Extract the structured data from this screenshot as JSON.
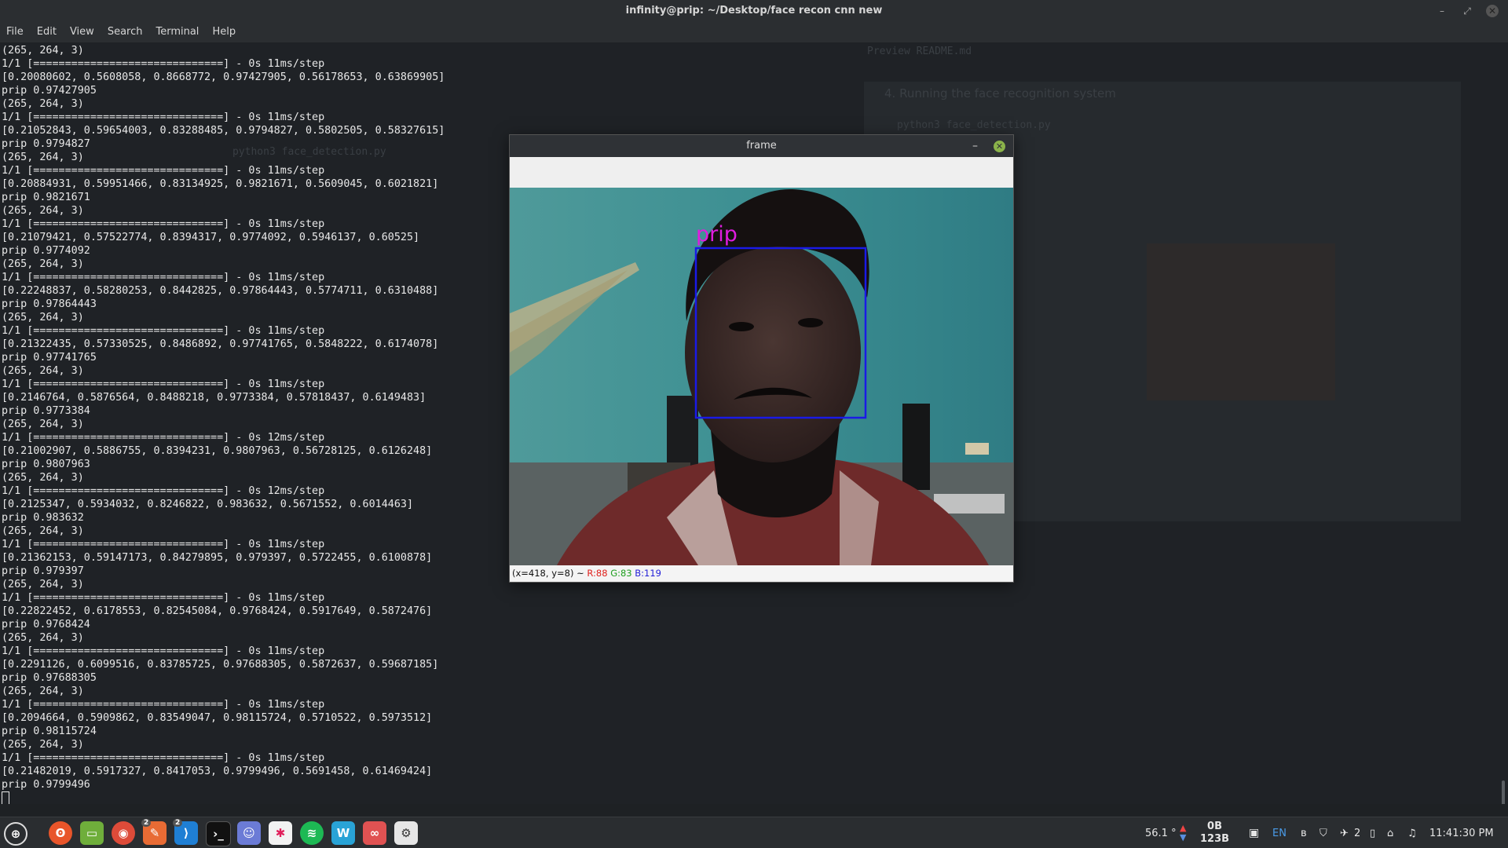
{
  "window": {
    "title": "infinity@prip: ~/Desktop/face recon cnn new"
  },
  "menu": [
    "File",
    "Edit",
    "View",
    "Search",
    "Terminal",
    "Help"
  ],
  "terminal": {
    "lines": [
      "(265, 264, 3)",
      "1/1 [==============================] - 0s 11ms/step",
      "[0.20080602, 0.5608058, 0.8668772, 0.97427905, 0.56178653, 0.63869905]",
      "prip 0.97427905",
      "(265, 264, 3)",
      "1/1 [==============================] - 0s 11ms/step",
      "[0.21052843, 0.59654003, 0.83288485, 0.9794827, 0.5802505, 0.58327615]",
      "prip 0.9794827",
      "(265, 264, 3)",
      "1/1 [==============================] - 0s 11ms/step",
      "[0.20884931, 0.59951466, 0.83134925, 0.9821671, 0.5609045, 0.6021821]",
      "prip 0.9821671",
      "(265, 264, 3)",
      "1/1 [==============================] - 0s 11ms/step",
      "[0.21079421, 0.57522774, 0.8394317, 0.9774092, 0.5946137, 0.60525]",
      "prip 0.9774092",
      "(265, 264, 3)",
      "1/1 [==============================] - 0s 11ms/step",
      "[0.22248837, 0.58280253, 0.8442825, 0.97864443, 0.5774711, 0.6310488]",
      "prip 0.97864443",
      "(265, 264, 3)",
      "1/1 [==============================] - 0s 11ms/step",
      "[0.21322435, 0.57330525, 0.8486892, 0.97741765, 0.5848222, 0.6174078]",
      "prip 0.97741765",
      "(265, 264, 3)",
      "1/1 [==============================] - 0s 11ms/step",
      "[0.2146764, 0.5876564, 0.8488218, 0.9773384, 0.57818437, 0.6149483]",
      "prip 0.9773384",
      "(265, 264, 3)",
      "1/1 [==============================] - 0s 12ms/step",
      "[0.21002907, 0.5886755, 0.8394231, 0.9807963, 0.56728125, 0.6126248]",
      "prip 0.9807963",
      "(265, 264, 3)",
      "1/1 [==============================] - 0s 12ms/step",
      "[0.2125347, 0.5934032, 0.8246822, 0.983632, 0.5671552, 0.6014463]",
      "prip 0.983632",
      "(265, 264, 3)",
      "1/1 [==============================] - 0s 11ms/step",
      "[0.21362153, 0.59147173, 0.84279895, 0.979397, 0.5722455, 0.6100878]",
      "prip 0.979397",
      "(265, 264, 3)",
      "1/1 [==============================] - 0s 11ms/step",
      "[0.22822452, 0.6178553, 0.82545084, 0.9768424, 0.5917649, 0.5872476]",
      "prip 0.9768424",
      "(265, 264, 3)",
      "1/1 [==============================] - 0s 11ms/step",
      "[0.2291126, 0.6099516, 0.83785725, 0.97688305, 0.5872637, 0.59687185]",
      "prip 0.97688305",
      "(265, 264, 3)",
      "1/1 [==============================] - 0s 11ms/step",
      "[0.2094664, 0.5909862, 0.83549047, 0.98115724, 0.5710522, 0.5973512]",
      "prip 0.98115724",
      "(265, 264, 3)",
      "1/1 [==============================] - 0s 11ms/step",
      "[0.21482019, 0.5917327, 0.8417053, 0.9799496, 0.5691458, 0.61469424]",
      "prip 0.9799496"
    ]
  },
  "background_editor": {
    "tabs": [
      "README.md",
      "Preview README.md"
    ],
    "heading": "4. Running the face recognition system",
    "code": "python3 face_detection.py"
  },
  "frame": {
    "title": "frame",
    "label": "prip",
    "label_color": "#e01ce0",
    "box_color": "#1a1ae6",
    "status_prefix": "(x=418, y=8) ~",
    "status_r": "R:88",
    "status_g": "G:83",
    "status_b": "B:119"
  },
  "taskbar": {
    "apps": [
      {
        "name": "menu-icon"
      },
      {
        "name": "firefox-icon"
      },
      {
        "name": "files-icon"
      },
      {
        "name": "chrome-icon"
      },
      {
        "name": "git-icon",
        "badge": "2"
      },
      {
        "name": "vscode-icon",
        "badge": "2"
      },
      {
        "name": "terminal-icon"
      },
      {
        "name": "discord-icon"
      },
      {
        "name": "slack-icon"
      },
      {
        "name": "spotify-icon"
      },
      {
        "name": "wps-icon"
      },
      {
        "name": "glasses-icon"
      },
      {
        "name": "settings-icon"
      }
    ],
    "temperature": "56.1 °",
    "net_up": "0B",
    "net_down": "123B",
    "lang": "EN",
    "notif_count": "2",
    "clock": "11:41:30 PM"
  }
}
